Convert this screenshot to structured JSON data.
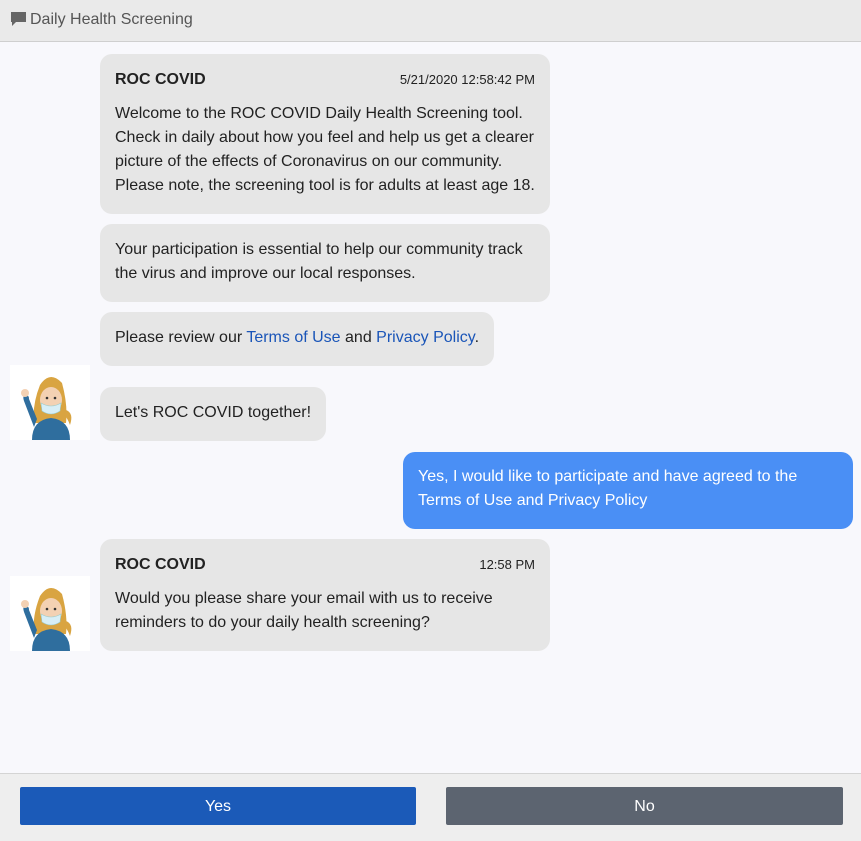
{
  "window": {
    "title": "Daily Health Screening",
    "icon": "chat-bubble-icon"
  },
  "messages": [
    {
      "sender": "ROC COVID",
      "timestamp": "5/21/2020 12:58:42 PM",
      "text": "Welcome to the ROC COVID Daily Health Screening tool. Check in daily about how you feel and help us get a clearer picture of the effects of Coronavirus on our community. Please note, the screening tool is for adults at least age 18."
    },
    {
      "text": "Your participation is essential to help our community track the virus and improve our local responses."
    },
    {
      "text_before": "Please review our ",
      "link1": "Terms of Use",
      "text_middle": " and ",
      "link2": "Privacy Policy",
      "text_after": "."
    },
    {
      "text": "Let's ROC COVID together!"
    },
    {
      "sender": "ROC COVID",
      "timestamp": "12:58 PM",
      "text": "Would you please share your email with us to receive reminders to do your daily health screening?"
    }
  ],
  "user_message": {
    "text": "Yes, I would like to participate and have agreed to the Terms of Use and Privacy Policy"
  },
  "avatar": {
    "icon": "nurse-waving-avatar-icon"
  },
  "actions": {
    "yes_label": "Yes",
    "no_label": "No"
  },
  "colors": {
    "bot_bubble": "#e6e6e6",
    "user_bubble": "#4a8ff5",
    "link": "#1a55b8",
    "yes_button": "#1b5ab8",
    "no_button": "#5c6470"
  }
}
